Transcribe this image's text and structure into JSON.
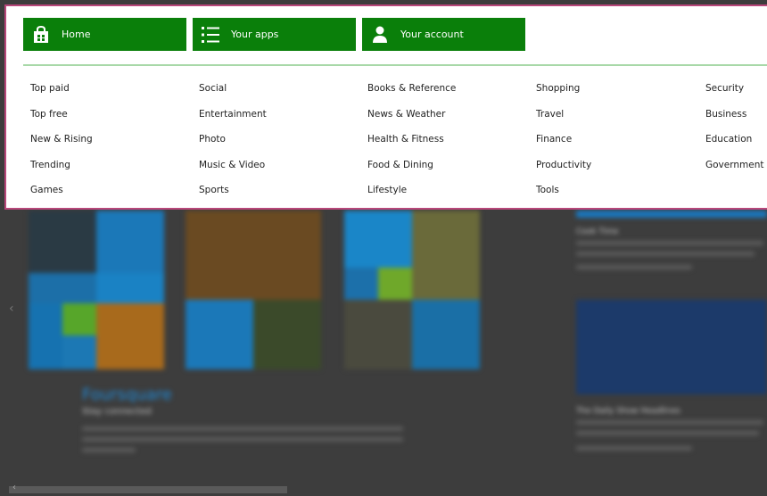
{
  "nav": {
    "tiles": [
      {
        "label": "Home",
        "icon": "shopping-bag-icon"
      },
      {
        "label": "Your apps",
        "icon": "list-icon"
      },
      {
        "label": "Your account",
        "icon": "person-icon"
      }
    ],
    "categories": [
      [
        "Top paid",
        "Top free",
        "New & Rising",
        "Trending",
        "Games"
      ],
      [
        "Social",
        "Entertainment",
        "Photo",
        "Music & Video",
        "Sports"
      ],
      [
        "Books & Reference",
        "News & Weather",
        "Health & Fitness",
        "Food & Dining",
        "Lifestyle"
      ],
      [
        "Shopping",
        "Travel",
        "Finance",
        "Productivity",
        "Tools"
      ],
      [
        "Security",
        "Business",
        "Education",
        "Government"
      ]
    ]
  },
  "background": {
    "featured_title": "Foursquare",
    "featured_subtitle": "Stay connected",
    "card_1_title": "Cook Time",
    "card_2_title": "The Daily Show Headlines"
  },
  "colors": {
    "tile_green": "#0a7f0a",
    "divider_green": "#a8d8a8",
    "panel_border": "#b8477a",
    "background": "#3d3d3d"
  }
}
